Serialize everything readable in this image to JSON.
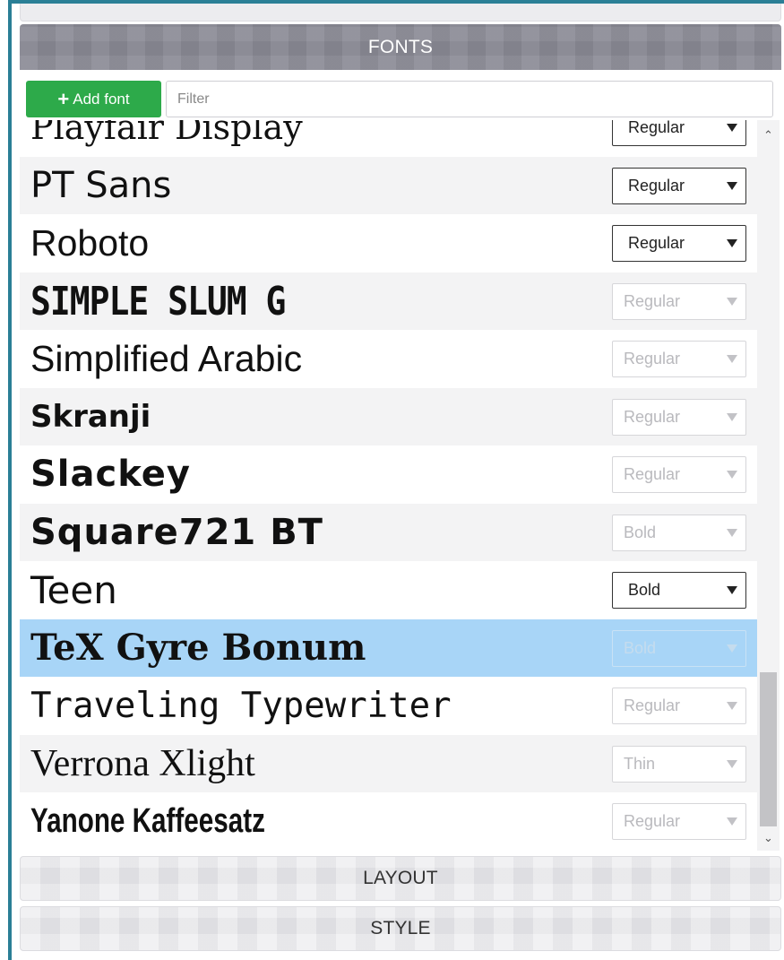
{
  "panel": {
    "fonts_title": "FONTS",
    "layout_title": "LAYOUT",
    "style_title": "STYLE"
  },
  "toolbar": {
    "add_font_label": "Add font",
    "add_font_icon": "plus-icon",
    "filter_placeholder": "Filter",
    "filter_value": ""
  },
  "fonts": [
    {
      "name": "Playfair Display",
      "weight": "Regular",
      "enabled": true
    },
    {
      "name": "PT Sans",
      "weight": "Regular",
      "enabled": true
    },
    {
      "name": "Roboto",
      "weight": "Regular",
      "enabled": true
    },
    {
      "name": "SIMPLE SLUM G",
      "weight": "Regular",
      "enabled": false
    },
    {
      "name": "Simplified Arabic",
      "weight": "Regular",
      "enabled": false
    },
    {
      "name": "Skranji",
      "weight": "Regular",
      "enabled": false
    },
    {
      "name": "Slackey",
      "weight": "Regular",
      "enabled": false
    },
    {
      "name": "Square721 BT",
      "weight": "Bold",
      "enabled": false
    },
    {
      "name": "Teen",
      "weight": "Bold",
      "enabled": true
    },
    {
      "name": "TeX Gyre Bonum",
      "weight": "Bold",
      "enabled": false,
      "selected": true
    },
    {
      "name": "Traveling Typewriter",
      "weight": "Regular",
      "enabled": false
    },
    {
      "name": "Verrona Xlight",
      "weight": "Thin",
      "enabled": false
    },
    {
      "name": "Yanone Kaffeesatz",
      "weight": "Regular",
      "enabled": false
    }
  ],
  "colors": {
    "frame_border": "#2a7f96",
    "add_button": "#2daa4a",
    "fonts_header": "#8a8a95",
    "selected_row": "#a8d5f7"
  }
}
